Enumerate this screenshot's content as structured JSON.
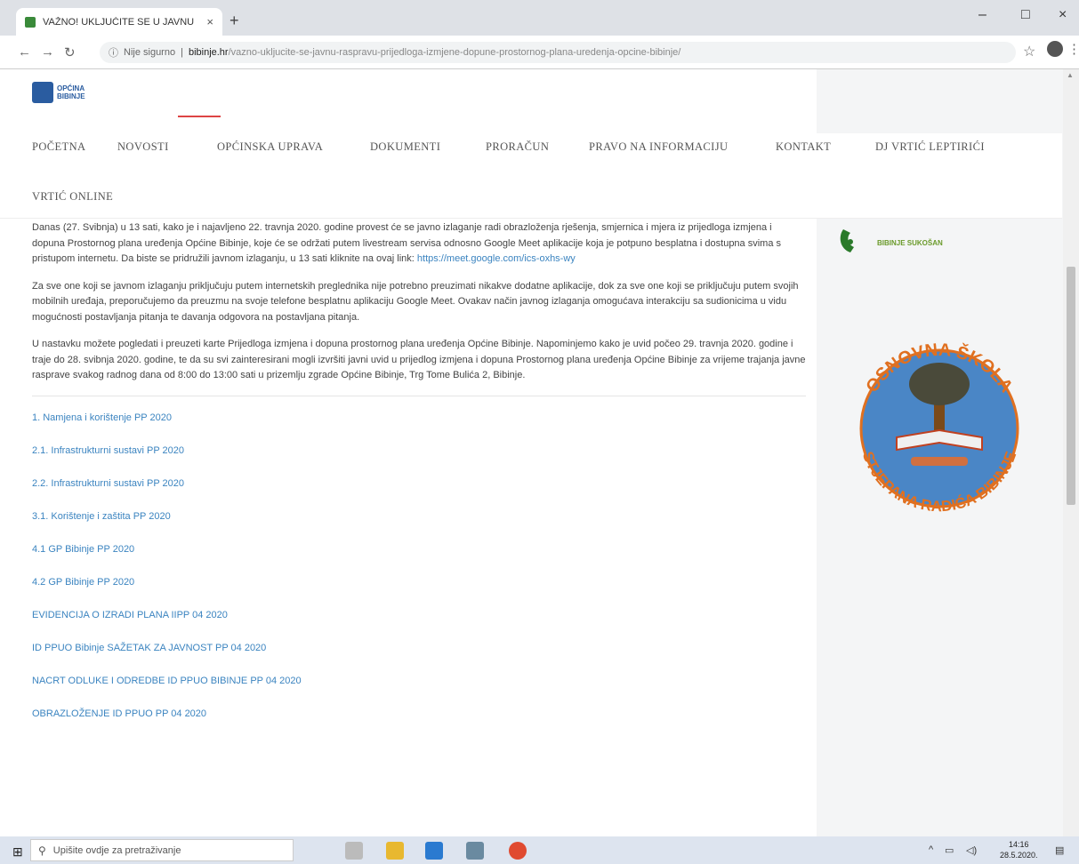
{
  "browser": {
    "tab_title": "VAŽNO! UKLJUČITE SE U JAVNU",
    "tab_close": "×",
    "new_tab": "+",
    "minimize": "–",
    "maximize": "□",
    "close": "×",
    "url_security": "Nije sigurno",
    "url_domain": "bibinje.hr",
    "url_path": "/vazno-ukljucite-se-javnu-raspravu-prijedloga-izmjene-dopune-prostornog-plana-uredenja-opcine-bibinje/"
  },
  "logo": {
    "line1": "OPĆINA",
    "line2": "BIBINJE"
  },
  "nav": {
    "items": [
      "POČETNA",
      "NOVOSTI",
      "OPĆINSKA UPRAVA",
      "DOKUMENTI",
      "PRORAČUN",
      "PRAVO NA INFORMACIJU",
      "KONTAKT",
      "DJ VRTIĆ LEPTIRIĆI"
    ],
    "second_row": "VRTIĆ ONLINE"
  },
  "content": {
    "p1": "Danas (27. Svibnja) u 13 sati, kako je i najavljeno 22. travnja 2020. godine provest će se javno izlaganje radi obrazloženja rješenja, smjernica i mjera iz prijedloga izmjena i dopuna Prostornog plana uređenja Općine Bibinje, koje će se održati putem livestream servisa odnosno Google Meet aplikacije koja je potpuno besplatna i dostupna svima s pristupom internetu. Da biste se pridružili javnom izlaganju, u 13 sati kliknite na ovaj link: ",
    "p1_link": "https://meet.google.com/ics-oxhs-wy",
    "p2": "Za sve one koji se javnom izlaganju priključuju putem internetskih preglednika nije potrebno preuzimati nikakve dodatne aplikacije, dok za sve one koji se priključuju putem svojih mobilnih uređaja, preporučujemo da preuzmu na svoje telefone besplatnu aplikaciju Google Meet. Ovakav način javnog izlaganja omogućava interakciju sa sudionicima u vidu mogućnosti postavljanja pitanja te davanja odgovora na postavljana pitanja.",
    "p3": "U nastavku možete pogledati i preuzeti karte Prijedloga izmjena i dopuna prostornog plana uređenja Općine Bibinje. Napominjemo kako je uvid počeo 29. travnja 2020. godine i traje do 28. svibnja 2020. godine, te da su svi zainteresirani mogli izvršiti javni uvid u prijedlog izmjena i dopuna Prostornog plana uređenja Općine Bibinje za vrijeme trajanja javne rasprave svakog radnog dana od 8:00 do 13:00 sati u prizemlju zgrade Općine Bibinje, Trg Tome Bulića 2, Bibinje."
  },
  "links": [
    "1. Namjena i korištenje PP 2020",
    "2.1. Infrastrukturni sustavi PP 2020",
    "2.2. Infrastrukturni sustavi PP 2020",
    "3.1. Korištenje i zaštita PP 2020",
    "4.1 GP Bibinje PP 2020",
    "4.2 GP Bibinje PP 2020",
    "EVIDENCIJA O IZRADI PLANA IIPP 04 2020",
    "ID PPUO Bibinje SAŽETAK ZA JAVNOST PP 04 2020",
    "NACRT ODLUKE I ODREDBE ID PPUO BIBINJE PP 04 2020",
    "OBRAZLOŽENJE ID PPUO PP 04 2020"
  ],
  "sidebar": {
    "school_top": "OSNOVNA ŠKOLA",
    "school_bottom": "STJEPANA RADIĆA BIBINJE",
    "banner_sub": "BIBINJE SUKOŠAN"
  },
  "taskbar": {
    "search_placeholder": "Upišite ovdje za pretraživanje",
    "time": "14:16",
    "date": "28.5.2020."
  },
  "colors": {
    "link": "#3b84c0",
    "nav_text": "#555555",
    "taskbar": "#dde4ef"
  }
}
